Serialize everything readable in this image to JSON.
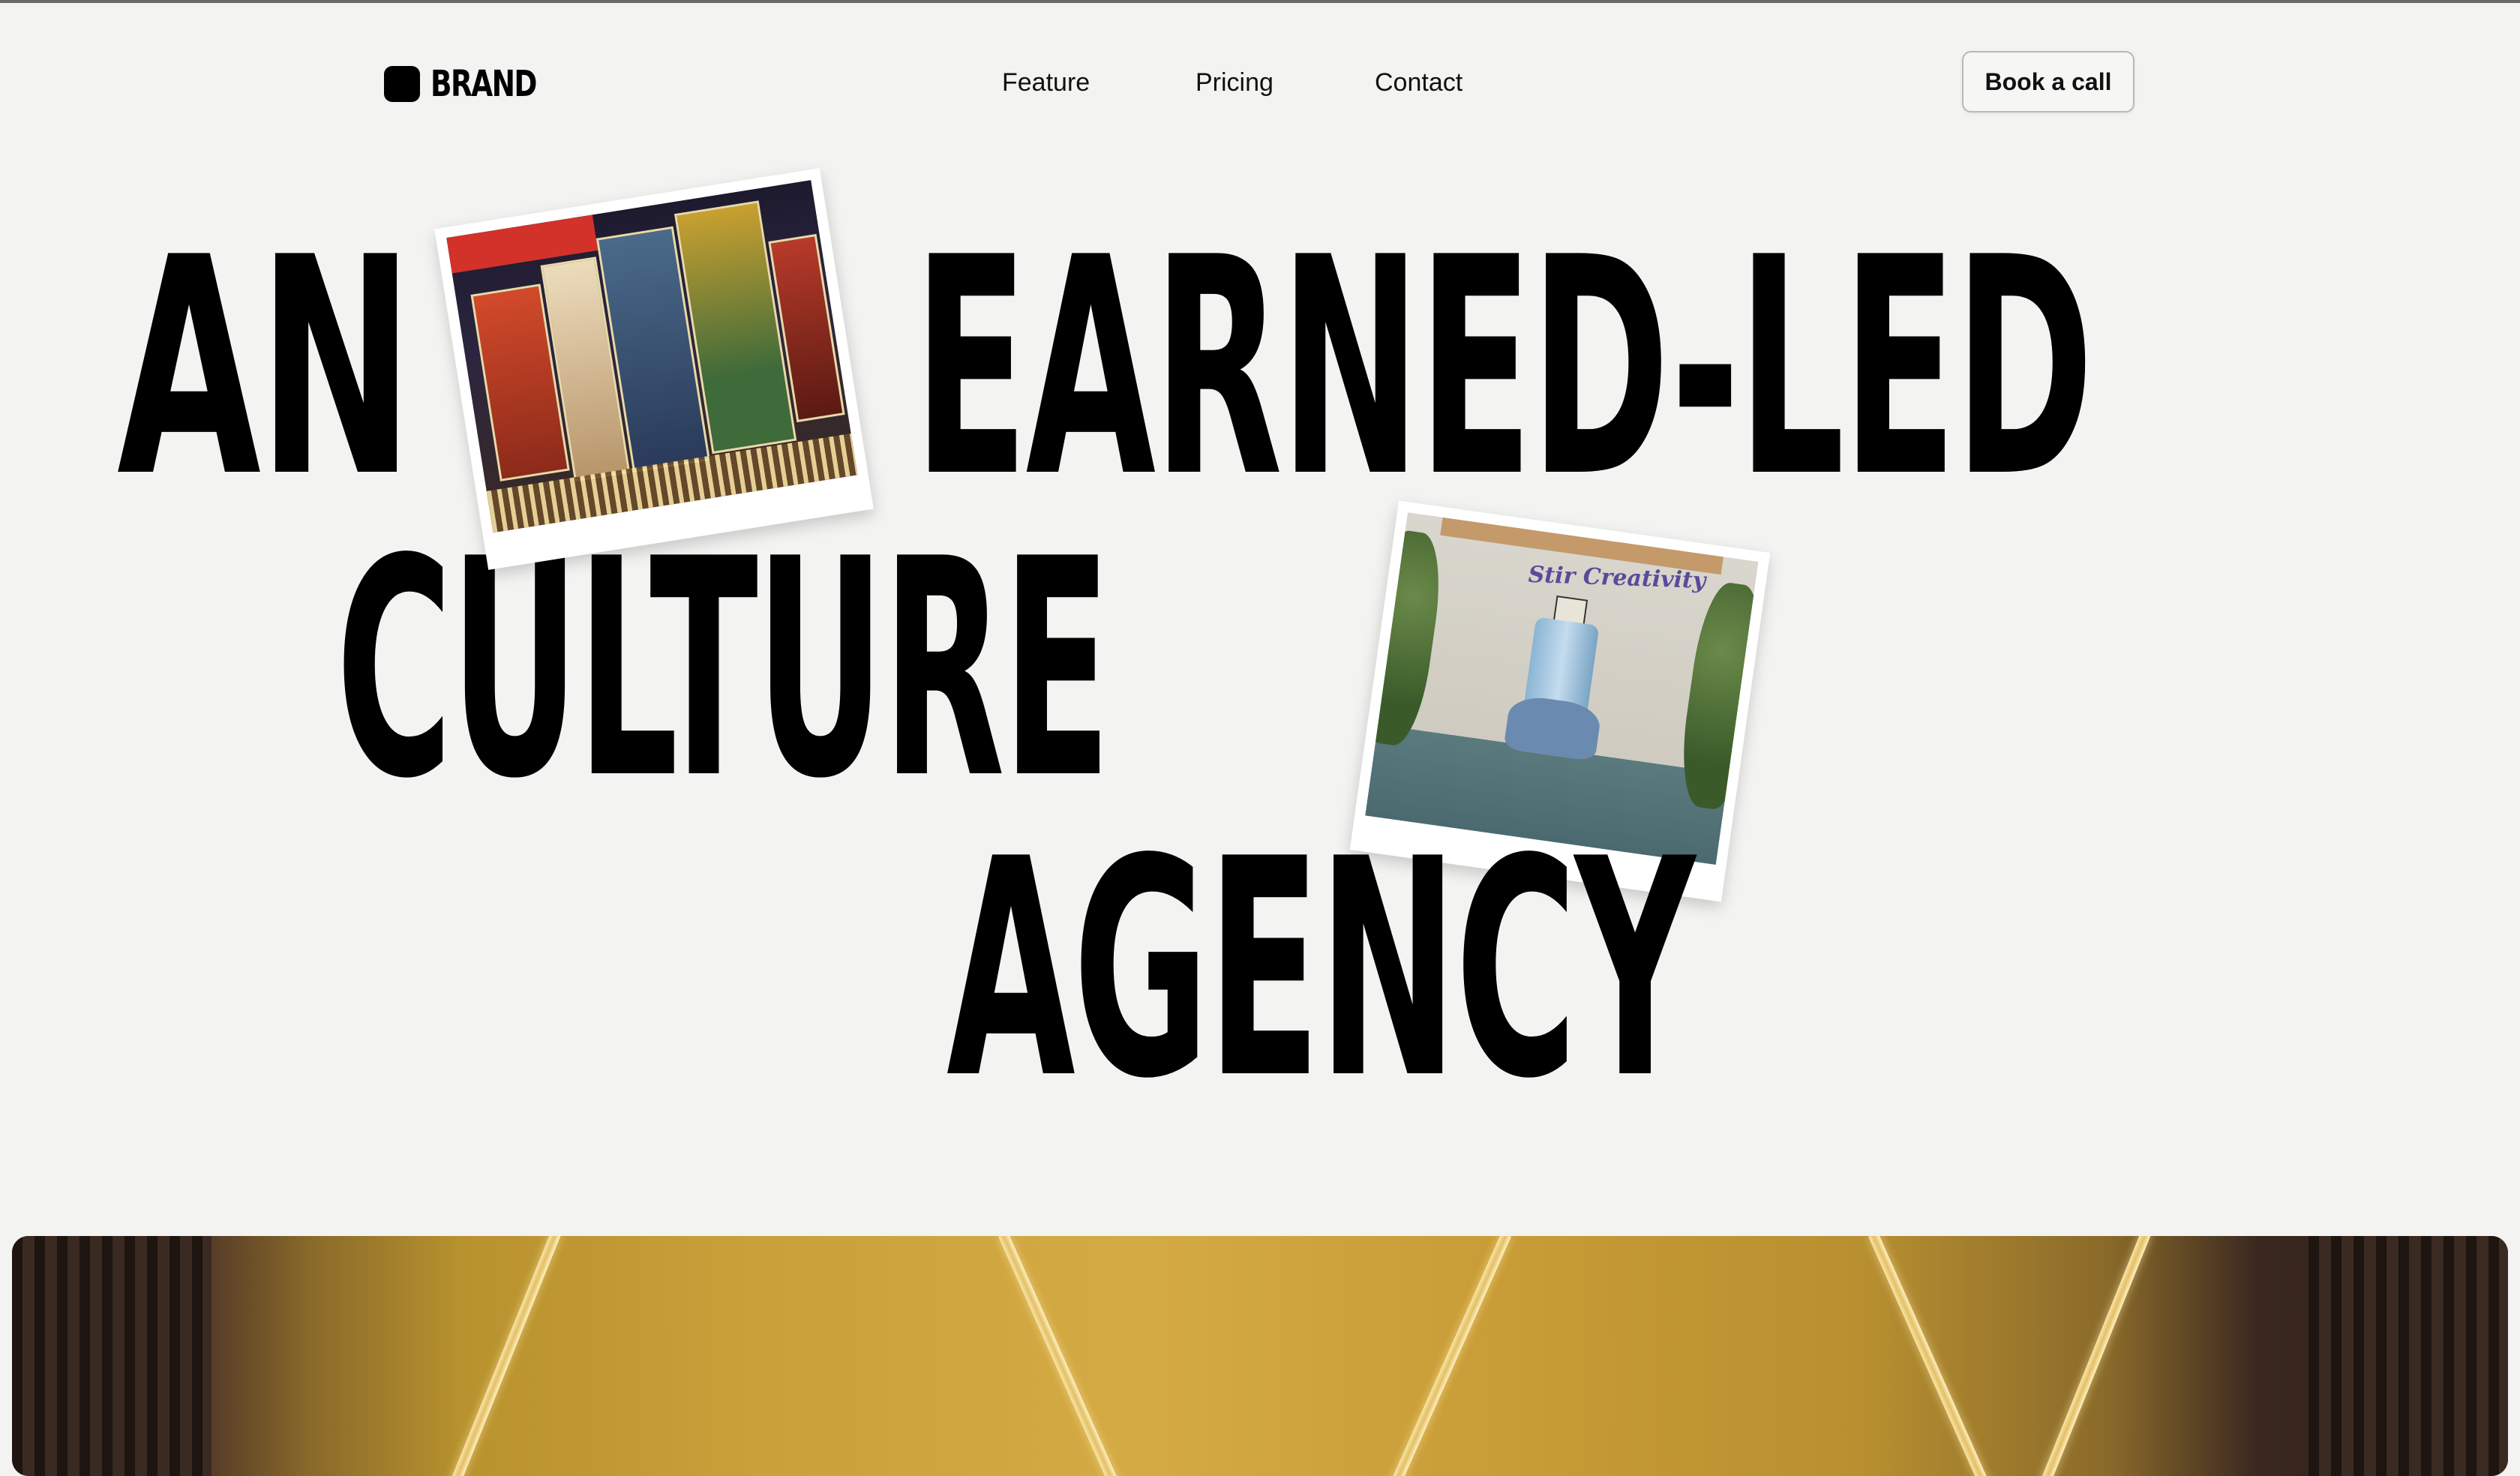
{
  "brand": {
    "name": "BRAND"
  },
  "nav": {
    "links": [
      {
        "label": "Feature"
      },
      {
        "label": "Pricing"
      },
      {
        "label": "Contact"
      }
    ],
    "cta_label": "Book a call"
  },
  "headline": {
    "line1_word1": "AN",
    "line1_word2": "EARNED-LED",
    "line2": "CULTURE",
    "line3": "AGENCY"
  },
  "photo_2": {
    "ad_text": "Stir Creativity"
  },
  "colors": {
    "background": "#f3f3f1",
    "text": "#000000",
    "accent_gold": "#caa03a"
  }
}
